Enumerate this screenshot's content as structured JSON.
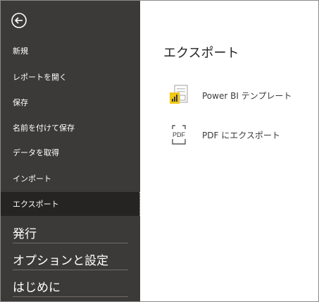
{
  "sidebar": {
    "back_icon": "back-arrow-icon",
    "items": [
      {
        "label": "新規"
      },
      {
        "label": "レポートを開く"
      },
      {
        "label": "保存"
      },
      {
        "label": "名前を付けて保存"
      },
      {
        "label": "データを取得"
      },
      {
        "label": "インポート"
      },
      {
        "label": "エクスポート",
        "selected": true
      }
    ],
    "large_items": [
      {
        "label": "発行"
      },
      {
        "label": "オプションと設定"
      },
      {
        "label": "はじめに"
      }
    ]
  },
  "main": {
    "title": "エクスポート",
    "options": [
      {
        "label": "Power  BI テンプレート",
        "icon": "powerbi-template-icon"
      },
      {
        "label": "PDF にエクスポート",
        "icon": "pdf-icon",
        "icon_text": "PDF"
      }
    ]
  },
  "colors": {
    "sidebar_bg": "#3b3a39",
    "selected_bg": "#252423",
    "accent": "#f2c811"
  }
}
